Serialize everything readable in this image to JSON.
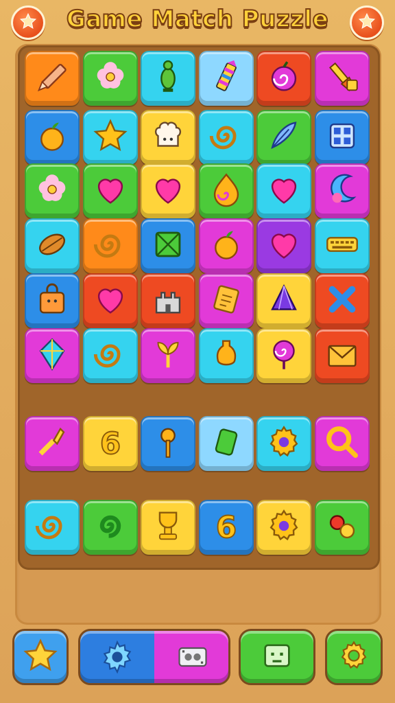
{
  "header": {
    "title": "Game Match Puzzle",
    "left_button_icon": "star-icon",
    "right_button_icon": "star-icon"
  },
  "colors": {
    "orange": "#ff8a1a",
    "green": "#4ccb3a",
    "cyan": "#35d3ef",
    "lightblue": "#8ed8ff",
    "red": "#ee4a22",
    "magenta": "#e23ad8",
    "blue": "#2d8ee8",
    "yellow": "#ffd43a",
    "purple": "#9a3ae2"
  },
  "board": {
    "rows": [
      [
        {
          "color": "orange",
          "icon": "pencil-icon"
        },
        {
          "color": "green",
          "icon": "flower-icon"
        },
        {
          "color": "cyan",
          "icon": "pin-icon"
        },
        {
          "color": "lightblue",
          "icon": "crayon-icon"
        },
        {
          "color": "red",
          "icon": "spiral-fruit-icon"
        },
        {
          "color": "magenta",
          "icon": "brush-icon"
        }
      ],
      [
        {
          "color": "blue",
          "icon": "apple-icon"
        },
        {
          "color": "cyan",
          "icon": "star-icon"
        },
        {
          "color": "yellow",
          "icon": "chef-hat-icon"
        },
        {
          "color": "cyan",
          "icon": "spiral-icon"
        },
        {
          "color": "green",
          "icon": "feather-icon"
        },
        {
          "color": "blue",
          "icon": "grid-box-icon"
        }
      ],
      [
        {
          "color": "green",
          "icon": "flower-icon"
        },
        {
          "color": "green",
          "icon": "heart-icon"
        },
        {
          "color": "yellow",
          "icon": "heart-icon"
        },
        {
          "color": "green",
          "icon": "swirl-drop-icon"
        },
        {
          "color": "cyan",
          "icon": "heart-icon"
        },
        {
          "color": "magenta",
          "icon": "moon-wing-icon"
        }
      ],
      [
        {
          "color": "cyan",
          "icon": "leaf-icon"
        },
        {
          "color": "orange",
          "icon": "spiral-icon"
        },
        {
          "color": "blue",
          "icon": "crate-icon"
        },
        {
          "color": "magenta",
          "icon": "apple-icon"
        },
        {
          "color": "purple",
          "icon": "heart-icon"
        },
        {
          "color": "cyan",
          "icon": "keyboard-icon"
        }
      ],
      [
        {
          "color": "blue",
          "icon": "bag-icon"
        },
        {
          "color": "red",
          "icon": "heart-icon"
        },
        {
          "color": "red",
          "icon": "castle-icon"
        },
        {
          "color": "magenta",
          "icon": "note-icon"
        },
        {
          "color": "yellow",
          "icon": "gem-icon"
        },
        {
          "color": "red",
          "icon": "cross-icon"
        }
      ],
      [
        {
          "color": "magenta",
          "icon": "kite-icon"
        },
        {
          "color": "cyan",
          "icon": "spiral-icon"
        },
        {
          "color": "magenta",
          "icon": "sprout-icon"
        },
        {
          "color": "cyan",
          "icon": "vase-icon"
        },
        {
          "color": "yellow",
          "icon": "lollipop-icon"
        },
        {
          "color": "red",
          "icon": "envelope-icon"
        }
      ]
    ]
  },
  "tray": {
    "rows": [
      [
        {
          "color": "magenta",
          "icon": "crystal-wand-icon"
        },
        {
          "color": "yellow",
          "icon": "six-icon"
        },
        {
          "color": "blue",
          "icon": "key-pin-icon"
        },
        {
          "color": "lightblue",
          "icon": "battery-icon"
        },
        {
          "color": "cyan",
          "icon": "gear-icon"
        },
        {
          "color": "magenta",
          "icon": "magnifier-icon"
        }
      ],
      [
        {
          "color": "cyan",
          "icon": "spiral-icon"
        },
        {
          "color": "green",
          "icon": "swirl-icon"
        },
        {
          "color": "yellow",
          "icon": "trophy-icon"
        },
        {
          "color": "blue",
          "icon": "six-icon"
        },
        {
          "color": "yellow",
          "icon": "gear-icon"
        },
        {
          "color": "green",
          "icon": "berries-icon"
        }
      ]
    ]
  },
  "bottom_bar": {
    "star_button_icon": "star-icon",
    "booster_left_icon": "burst-gear-icon",
    "booster_right_icon": "film-icon",
    "menu_button_icon": "robot-face-icon",
    "settings_button_icon": "gear-icon"
  }
}
